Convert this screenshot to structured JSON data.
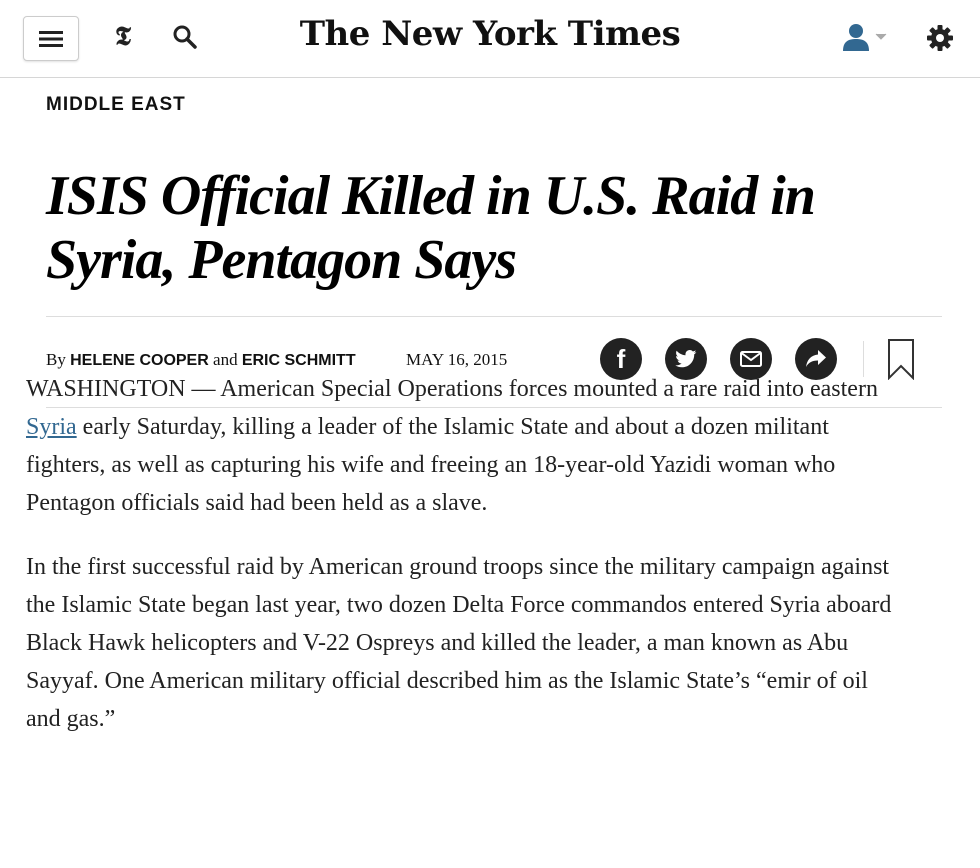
{
  "header": {
    "masthead": "The New York Times",
    "t_logo": "𝕿"
  },
  "article": {
    "section": "MIDDLE EAST",
    "headline": "ISIS Official Killed in U.S. Raid in Syria, Pentagon Says",
    "byline": {
      "by": "By",
      "author1": "HELENE COOPER",
      "and": "and",
      "author2": "ERIC SCHMITT"
    },
    "date": "MAY 16, 2015",
    "share_labels": {
      "facebook": "f"
    },
    "paragraph1": {
      "before_link": "WASHINGTON — American Special Operations forces mounted a rare raid into eastern ",
      "link": "Syria",
      "after_link": " early Saturday, killing a leader of the Islamic State and about a dozen militant fighters, as well as capturing his wife and freeing an 18-year-old Yazidi woman who Pentagon officials said had been held as a slave."
    },
    "paragraph2": "In the first successful raid by American ground troops since the military campaign against the Islamic State began last year, two dozen Delta Force commandos entered Syria aboard Black Hawk helicopters and V-22 Ospreys and killed the leader, a man known as Abu Sayyaf. One American military official described him as the Islamic State’s “emir of oil and gas.”"
  },
  "icons": {
    "menu": "hamburger-icon",
    "t_logo": "nyt-t-icon",
    "search": "search-icon",
    "user": "user-icon",
    "settings": "gear-icon",
    "facebook": "facebook-icon",
    "twitter": "twitter-icon",
    "email": "email-icon",
    "share": "share-icon",
    "save": "bookmark-icon"
  },
  "colors": {
    "link": "#326891",
    "user_icon": "#326891",
    "icon_dark": "#222222"
  }
}
